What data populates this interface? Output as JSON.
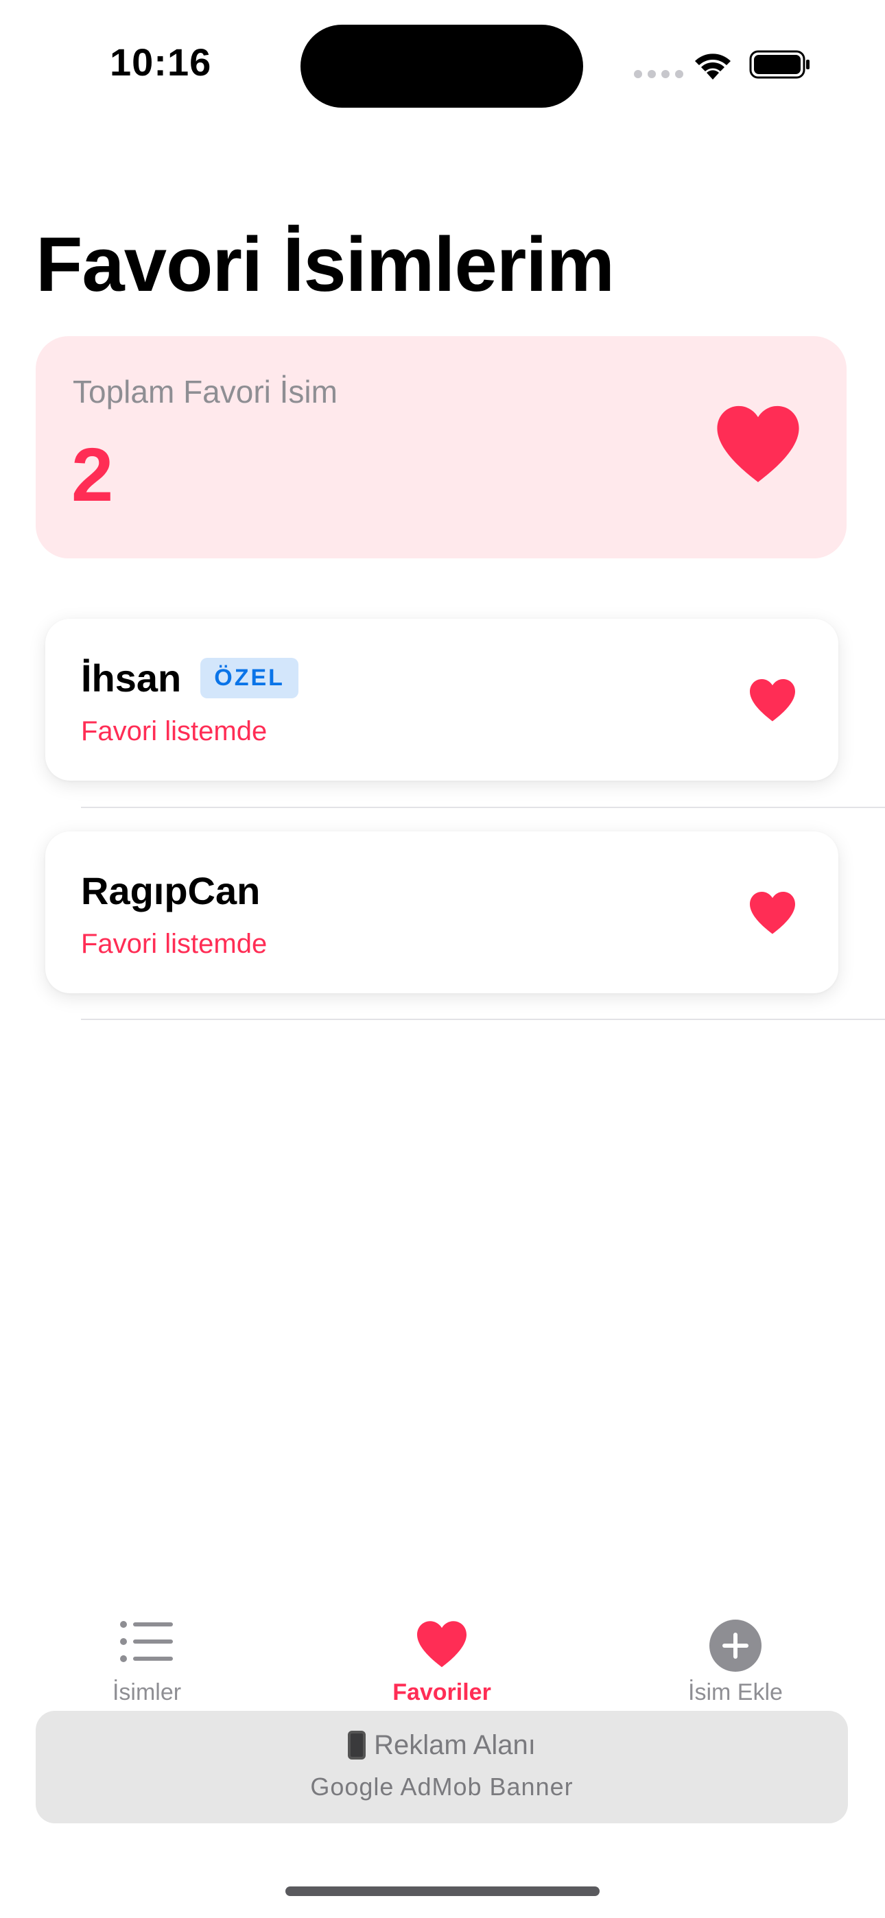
{
  "status_bar": {
    "time": "10:16"
  },
  "page": {
    "title": "Favori İsimlerim"
  },
  "summary": {
    "label": "Toplam Favori İsim",
    "count": "2",
    "icon": "heart-icon"
  },
  "favorites": [
    {
      "name": "İhsan",
      "badge": "ÖZEL",
      "subtitle": "Favori listemde",
      "icon": "heart-icon"
    },
    {
      "name": "RagıpCan",
      "subtitle": "Favori listemde",
      "icon": "heart-icon"
    }
  ],
  "tab_bar": {
    "items": [
      {
        "label": "İsimler",
        "icon": "list-icon",
        "selected": false
      },
      {
        "label": "Favoriler",
        "icon": "heart-icon",
        "selected": true
      },
      {
        "label": "İsim Ekle",
        "icon": "plus-circle-icon",
        "selected": false
      }
    ]
  },
  "ad": {
    "title": "Reklam Alanı",
    "subtitle": "Google AdMob Banner",
    "icon": "mobile-phone-icon"
  },
  "colors": {
    "accent": "#ff2d55",
    "summary_background": "#ffe9ec",
    "badge_background": "#d3e6fb",
    "badge_text": "#0a74e8",
    "inactive": "#8e8e93"
  }
}
